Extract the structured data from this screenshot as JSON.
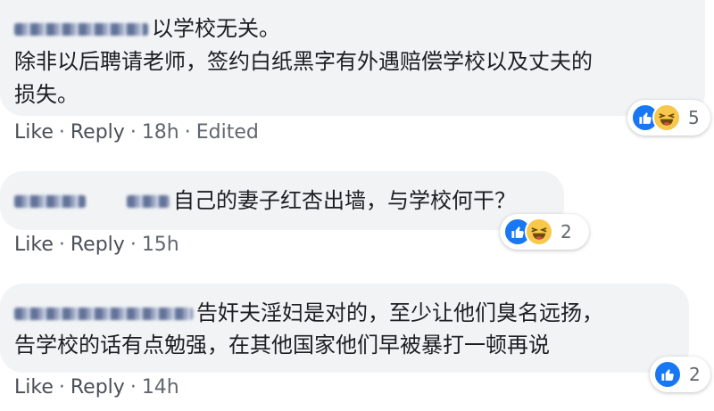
{
  "comments": [
    {
      "text_line1": "以学校无关。",
      "text_line2": "除非以后聘请老师，签约白纸黑字有外遇赔偿学校以及丈夫的",
      "text_line3": "损失。",
      "actions": {
        "like": "Like",
        "reply": "Reply",
        "time": "18h",
        "edited": "Edited"
      },
      "reactions": {
        "icons": [
          "like-icon",
          "haha-icon"
        ],
        "count": "5"
      }
    },
    {
      "text_line1": "自己的妻子红杏出墙，与学校何干？",
      "actions": {
        "like": "Like",
        "reply": "Reply",
        "time": "15h"
      },
      "reactions": {
        "icons": [
          "like-icon",
          "haha-icon"
        ],
        "count": "2"
      }
    },
    {
      "text_line1": "告奸夫淫妇是对的，至少让他们臭名远扬，",
      "text_line2": "告学校的话有点勉强，在其他国家他们早被暴打一顿再说",
      "actions": {
        "like": "Like",
        "reply": "Reply",
        "time": "14h"
      },
      "reactions": {
        "icons": [
          "like-icon"
        ],
        "count": "2"
      }
    }
  ],
  "separator": "·",
  "colors": {
    "bubble": "#f2f3f5",
    "like": "#1877f2",
    "haha": "#f7c84a",
    "meta": "#606770"
  }
}
